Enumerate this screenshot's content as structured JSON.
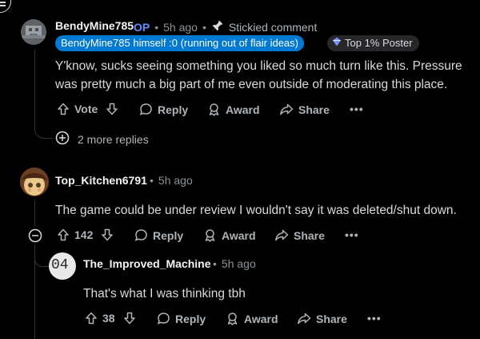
{
  "comments": [
    {
      "username": "BendyMine785",
      "op_label": "OP",
      "time": "5h ago",
      "stickied_label": "Stickied comment",
      "flair_user": "BendyMine785 himself :0 (running out of flair ideas)",
      "flair_rank": "Top 1% Poster",
      "body": "Y'know, sucks seeing something you liked so much turn like this. Pressure was pretty much a big part of me even outside of moderating this place.",
      "vote_label": "Vote",
      "reply_label": "Reply",
      "award_label": "Award",
      "share_label": "Share",
      "more_replies": "2 more replies"
    },
    {
      "username": "Top_Kitchen6791",
      "time": "5h ago",
      "body": "The game could be under review I wouldn't say it was deleted/shut down.",
      "vote_count": "142",
      "reply_label": "Reply",
      "award_label": "Award",
      "share_label": "Share"
    },
    {
      "username": "The_Improved_Machine",
      "time": "5h ago",
      "avatar_text": "04",
      "body": "That's what I was thinking tbh",
      "vote_count": "38",
      "reply_label": "Reply",
      "award_label": "Award",
      "share_label": "Share"
    }
  ],
  "colors": {
    "background": "#000000",
    "op": "#648efc",
    "flair_blue": "#0079d3",
    "text": "#d7dadc",
    "meta": "#8b9196"
  },
  "icons": [
    "menu-icon",
    "pin-icon",
    "upvote-icon",
    "downvote-icon",
    "reply-icon",
    "award-icon",
    "share-icon",
    "more-icon",
    "expand-icon",
    "collapse-icon",
    "rank-icon"
  ]
}
